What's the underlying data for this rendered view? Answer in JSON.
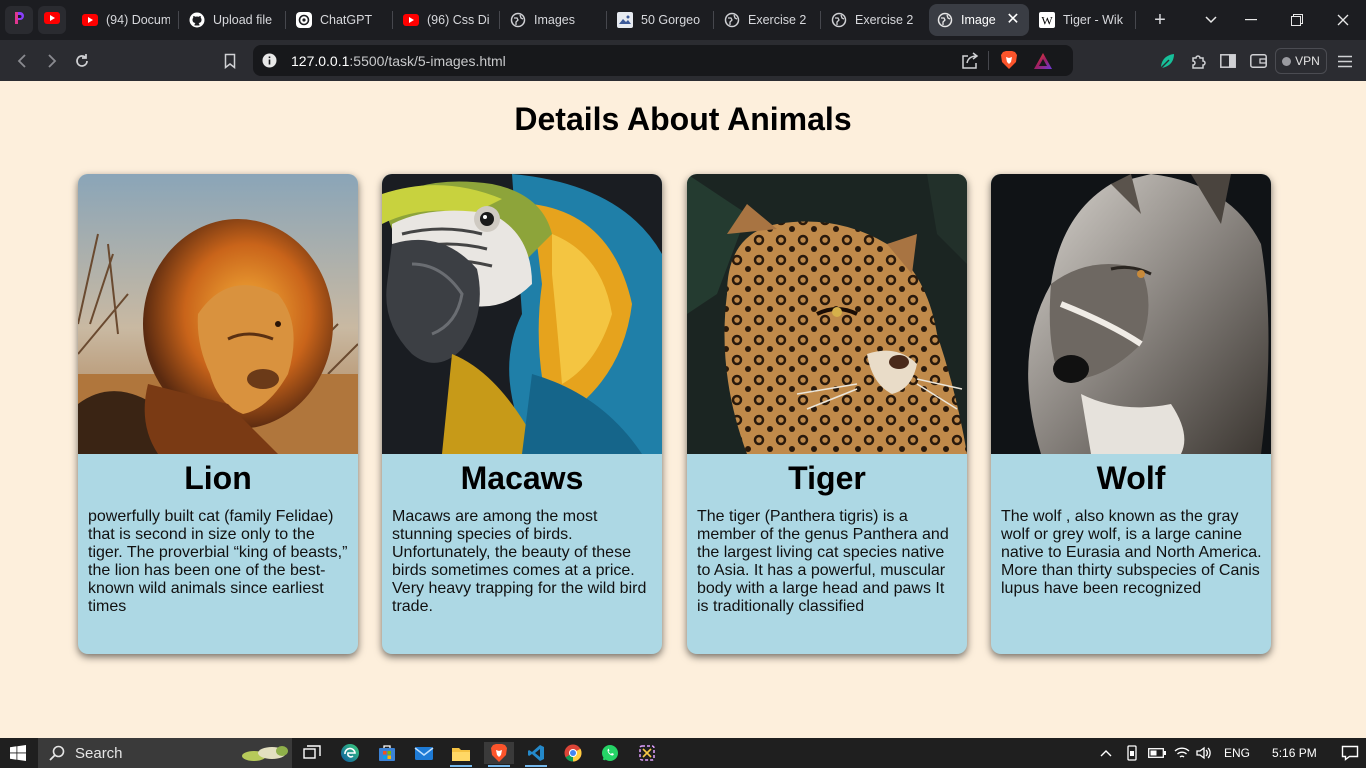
{
  "browser": {
    "tabs": [
      {
        "title": "(94) Docum",
        "icon": "youtube-icon"
      },
      {
        "title": "Upload file",
        "icon": "github-icon"
      },
      {
        "title": "ChatGPT",
        "icon": "chatgpt-icon"
      },
      {
        "title": "(96) Css Di",
        "icon": "youtube-icon"
      },
      {
        "title": "Images",
        "icon": "globe-icon"
      },
      {
        "title": "50 Gorgeo",
        "icon": "site-icon"
      },
      {
        "title": "Exercise 2",
        "icon": "globe-icon"
      },
      {
        "title": "Exercise 2",
        "icon": "globe-icon"
      },
      {
        "title": "Image",
        "icon": "globe-icon",
        "active": true
      },
      {
        "title": "Tiger - Wik",
        "icon": "wikipedia-icon"
      }
    ],
    "url_host": "127.0.0.1",
    "url_path": ":5500/task/5-images.html",
    "vpn_label": "VPN",
    "accent": "#fb542b"
  },
  "page": {
    "title": "Details About Animals",
    "background": "#fdefdc",
    "card_color": "#add8e4",
    "cards": [
      {
        "name": "Lion",
        "image": "lion-photo",
        "description": "powerfully built cat (family Felidae) that is second in size only to the tiger. The proverbial “king of beasts,” the lion has been one of the best-known wild animals since earliest times"
      },
      {
        "name": "Macaws",
        "image": "macaw-photo",
        "description": "Macaws are among the most stunning species of birds. Unfortunately, the beauty of these birds sometimes comes at a price. Very heavy trapping for the wild bird trade."
      },
      {
        "name": "Tiger",
        "image": "tiger-photo",
        "description": "The tiger (Panthera tigris) is a member of the genus Panthera and the largest living cat species native to Asia. It has a powerful, muscular body with a large head and paws It is traditionally classified"
      },
      {
        "name": "Wolf",
        "image": "wolf-photo",
        "description": "The wolf , also known as the gray wolf or grey wolf, is a large canine native to Eurasia and North America. More than thirty subspecies of Canis lupus have been recognized"
      }
    ]
  },
  "taskbar": {
    "search_label": "Search",
    "language": "ENG",
    "time": "5:16 PM"
  }
}
